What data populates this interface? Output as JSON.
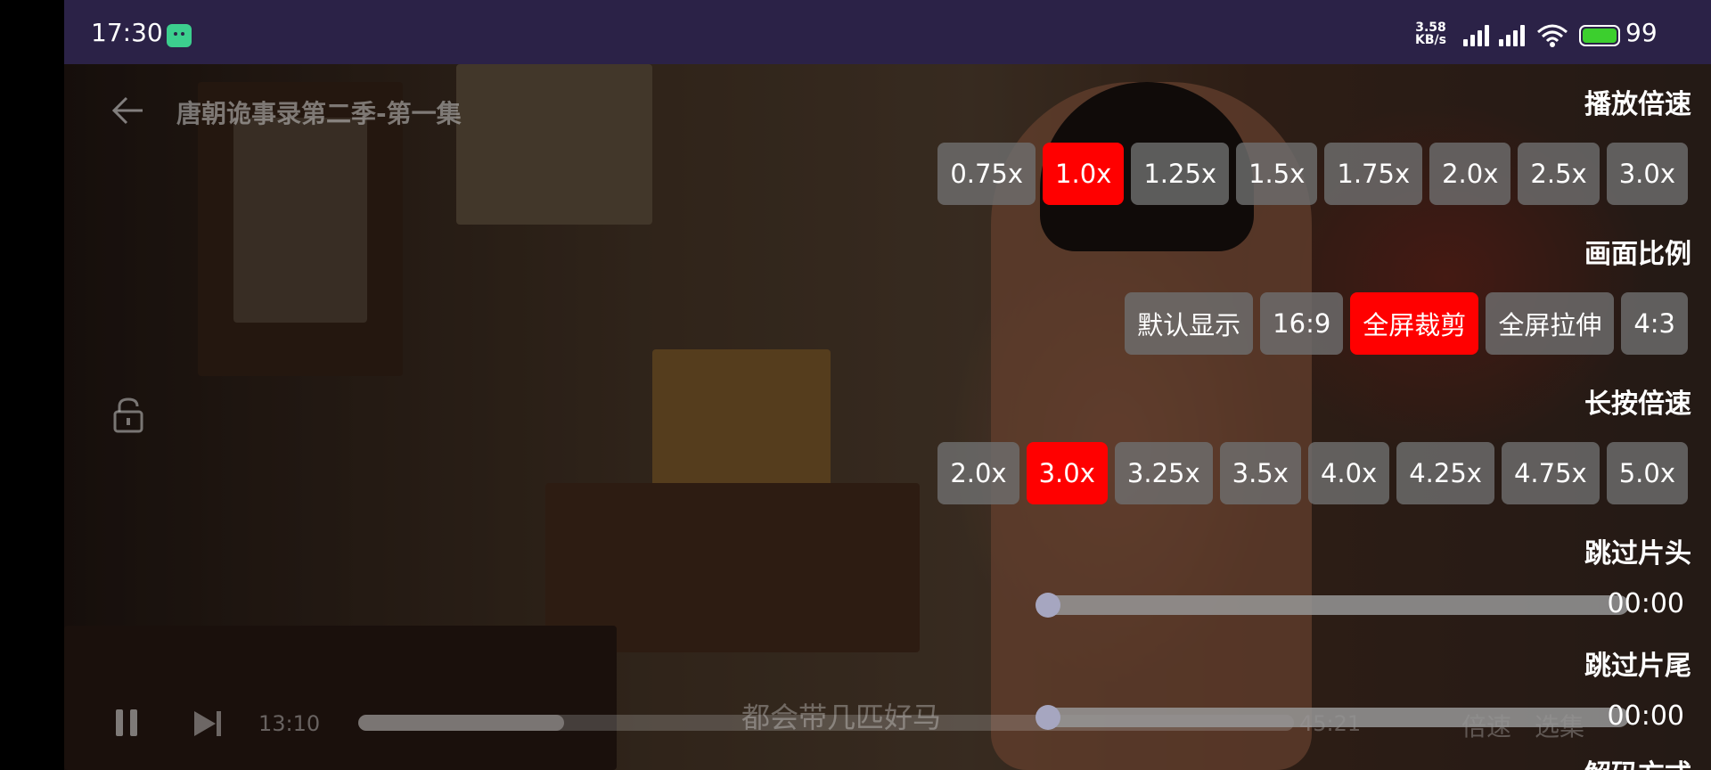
{
  "status_bar": {
    "time": "17:30",
    "net_speed_value": "3.58",
    "net_speed_unit": "KB/s",
    "battery": "99",
    "battery_color": "#3ccf2e"
  },
  "player": {
    "title": "唐朝诡事录第二季-第一集",
    "current_time": "13:10",
    "total_time": "45:21",
    "progress": 0.22,
    "subtitle": "都会带几匹好马",
    "speed_label": "倍速",
    "episodes_label": "选集"
  },
  "settings": {
    "playback_speed": {
      "title": "播放倍速",
      "options": [
        "0.75x",
        "1.0x",
        "1.25x",
        "1.5x",
        "1.75x",
        "2.0x",
        "2.5x",
        "3.0x"
      ],
      "selected": "1.0x"
    },
    "aspect_ratio": {
      "title": "画面比例",
      "options": [
        "默认显示",
        "16:9",
        "全屏裁剪",
        "全屏拉伸",
        "4:3"
      ],
      "selected": "全屏裁剪"
    },
    "long_press_speed": {
      "title": "长按倍速",
      "options": [
        "2.0x",
        "3.0x",
        "3.25x",
        "3.5x",
        "4.0x",
        "4.25x",
        "4.75x",
        "5.0x"
      ],
      "selected": "3.0x"
    },
    "skip_intro": {
      "title": "跳过片头",
      "value": "00:00",
      "fraction": 0
    },
    "skip_outro": {
      "title": "跳过片尾",
      "value": "00:00",
      "fraction": 0
    },
    "decoder": {
      "title": "解码方式"
    }
  },
  "colors": {
    "accent": "#ff0000",
    "status_bar_bg": "#2b2247",
    "chip_bg": "#6e6e6e"
  }
}
